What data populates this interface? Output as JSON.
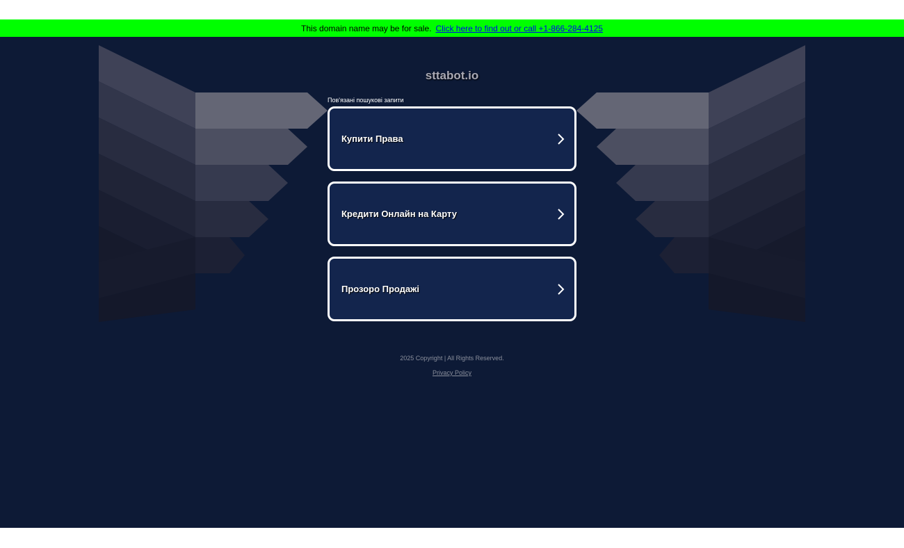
{
  "sale_bar": {
    "text": "This domain name may be for sale.",
    "link": "Click here to find out or call +1-866-284-4125",
    "bg_color": "#00ff00"
  },
  "domain": "sttabot.io",
  "related_label": "Пов'язані пошукові запити",
  "links": [
    {
      "label": "Купити Права",
      "icon": "chevron-right-icon"
    },
    {
      "label": "Кредити Онлайн на Карту",
      "icon": "chevron-right-icon"
    },
    {
      "label": "Прозоро Продажі",
      "icon": "chevron-right-icon"
    }
  ],
  "footer": {
    "copyright": "2025 Copyright | All Rights Reserved.",
    "privacy": "Privacy Policy"
  },
  "colors": {
    "background": "#0d1a36",
    "card": "#13254d",
    "card_border": "#ffffff"
  }
}
